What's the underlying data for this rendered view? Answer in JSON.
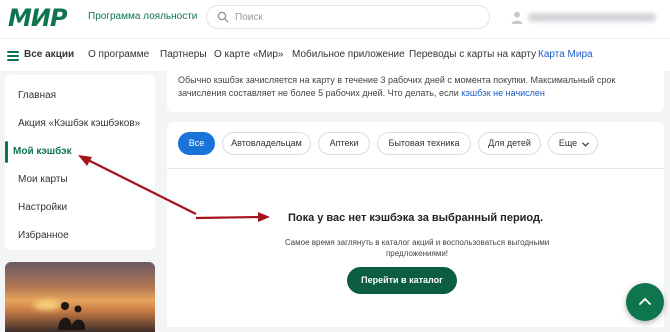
{
  "header": {
    "logo_text": "МИР",
    "logo_subtitle": "Программа лояльности",
    "search_placeholder": "Поиск"
  },
  "nav": {
    "all_promos": "Все акции",
    "items": [
      "О программе",
      "Партнеры",
      "О карте «Мир»",
      "Мобильное приложение",
      "Переводы с карты на карту",
      "Карта Мира"
    ],
    "active_item": "Карта Мира"
  },
  "sidebar": {
    "items": [
      "Главная",
      "Акция «Кэшбэк кэшбэков»",
      "Мой кэшбэк",
      "Мои карты",
      "Настройки",
      "Избранное"
    ],
    "active_item": "Мой кэшбэк"
  },
  "info": {
    "line1": "Обычно кэшбэк зачисляется на карту в течение 3 рабочих дней с момента покупки. Максимальный срок",
    "line2_text": "зачисления составляет не более 5 рабочих дней. Что делать, если",
    "line2_link": "кэшбэк не начислен"
  },
  "filters": {
    "chips": [
      "Все",
      "Автовладельцам",
      "Аптеки",
      "Бытовая техника",
      "Для детей",
      "Еще"
    ],
    "active": "Все"
  },
  "empty_state": {
    "title": "Пока у вас нет кэшбэка за выбранный период.",
    "text_line1": "Самое время заглянуть в каталог акций и воспользоваться выгодными",
    "text_line2": "предложениями!",
    "button": "Перейти в каталог"
  },
  "colors": {
    "brand_green": "#0f754e",
    "link_blue": "#1a5dc9",
    "chip_active": "#1a73d9",
    "annotation_arrow": "#a5141c"
  },
  "icons": {
    "search": "search-icon",
    "user": "user-icon",
    "menu": "menu-icon",
    "chevron": "chevron-down-icon",
    "fab": "chevron-up-icon"
  }
}
